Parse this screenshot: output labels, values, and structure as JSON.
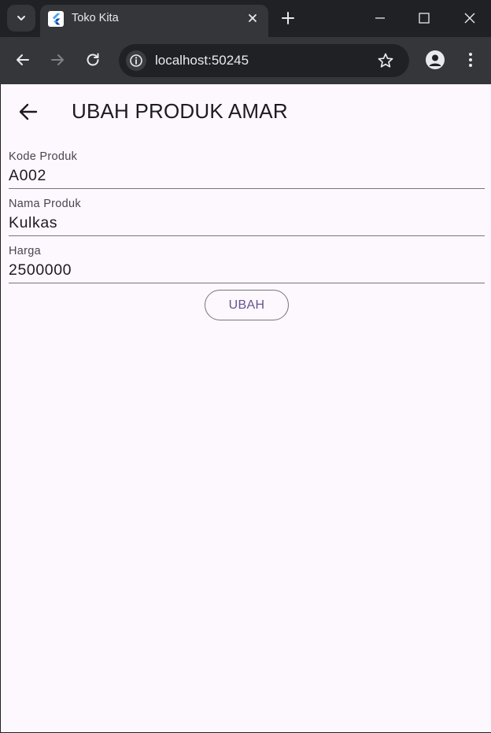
{
  "browser": {
    "tab_title": "Toko Kita",
    "url": "localhost:50245"
  },
  "app": {
    "title": "UBAH PRODUK AMAR",
    "form": {
      "fields": [
        {
          "label": "Kode Produk",
          "value": "A002"
        },
        {
          "label": "Nama Produk",
          "value": "Kulkas"
        },
        {
          "label": "Harga",
          "value": "2500000"
        }
      ],
      "submit_label": "UBAH"
    }
  },
  "colors": {
    "page_background": "#fdf7fe",
    "primary": "#65558f",
    "outline": "#79747e",
    "on_surface": "#1d1b20"
  },
  "icons": {
    "tab_search": "chevron-down-icon",
    "favicon": "flutter-logo-icon",
    "tab_close": "close-icon",
    "new_tab": "plus-icon",
    "back": "arrow-left-icon",
    "forward": "arrow-right-icon",
    "reload": "reload-icon",
    "site_info": "info-icon",
    "bookmark": "star-icon",
    "profile": "account-icon",
    "menu": "more-vert-icon",
    "app_back": "arrow-left-icon"
  }
}
